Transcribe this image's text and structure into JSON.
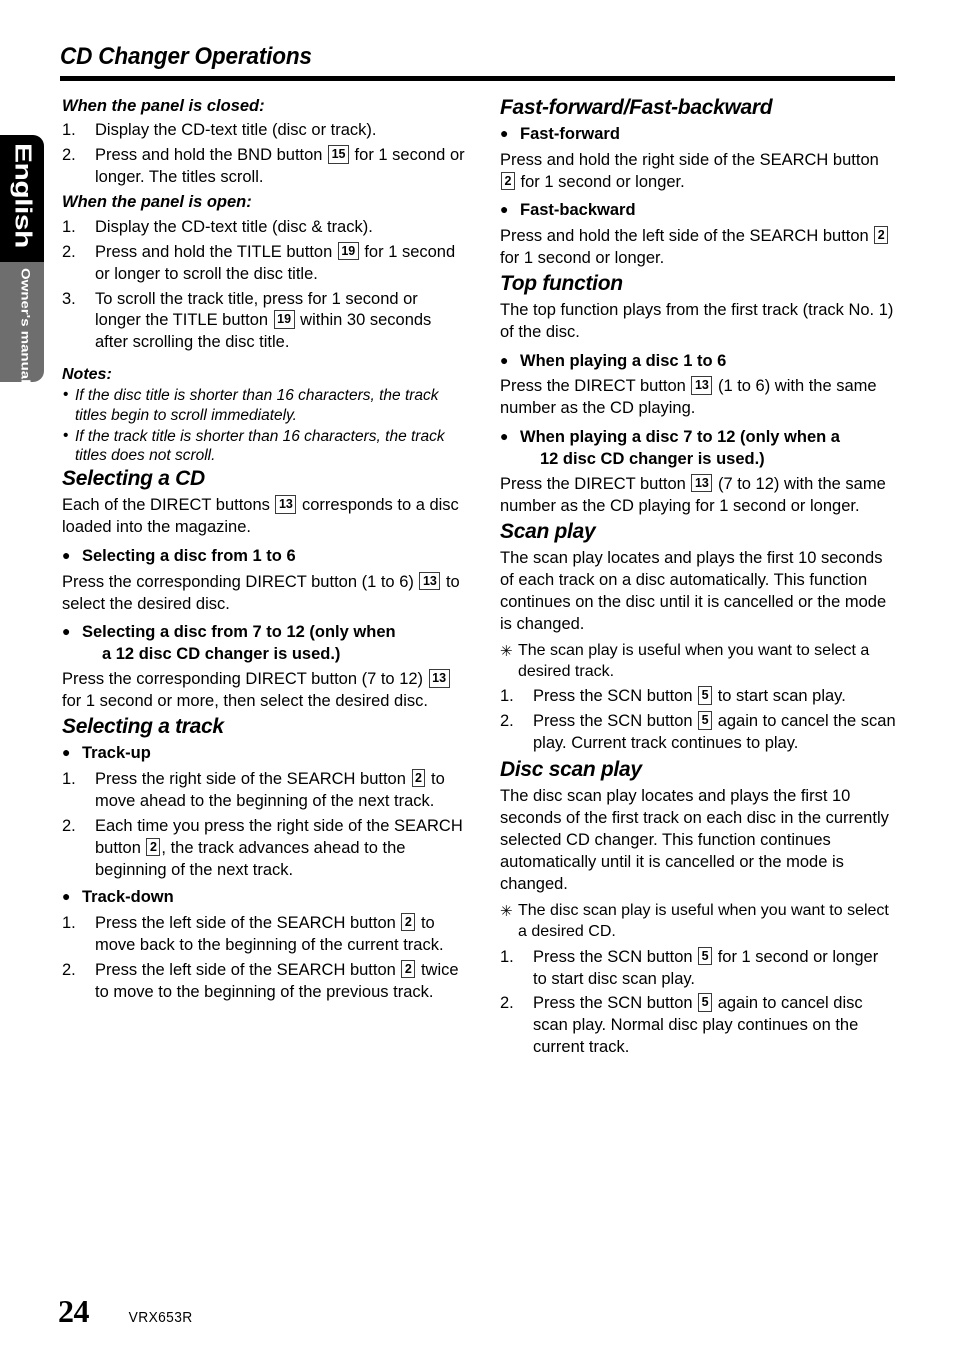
{
  "document": {
    "title": "CD Changer Operations",
    "language_tab": "English",
    "manual_tab": "Owner's manual",
    "page_number": "24",
    "model": "VRX653R"
  },
  "colors": {
    "tab_black": "#000000",
    "tab_gray": "#6e6e6e",
    "rule": "#000000",
    "text": "#000000"
  },
  "left_column": {
    "panel_closed": {
      "heading": "When the panel is closed:",
      "items": [
        {
          "num": "1.",
          "pre": "Display the CD-text title (disc or track).",
          "key": "",
          "post": ""
        },
        {
          "num": "2.",
          "pre": "Press and hold the BND button ",
          "key": "15",
          "post": " for 1 second or longer. The titles scroll."
        }
      ]
    },
    "panel_open": {
      "heading": "When the panel is open:",
      "items": [
        {
          "num": "1.",
          "pre": "Display the CD-text title (disc & track).",
          "key": "",
          "post": ""
        },
        {
          "num": "2.",
          "pre": "Press and hold the TITLE button ",
          "key": "19",
          "post": " for 1 second or longer to scroll the disc title."
        },
        {
          "num": "3.",
          "pre": "To scroll the track title, press for 1 second or longer the TITLE button ",
          "key": "19",
          "post": " within 30 seconds after scrolling the disc title."
        }
      ]
    },
    "notes": {
      "title": "Notes:",
      "items": [
        "If the disc title is shorter than 16 characters, the track titles begin to scroll immediately.",
        "If the track title is shorter than 16 characters, the track titles does not scroll."
      ]
    },
    "selecting_cd": {
      "heading": "Selecting a CD",
      "intro_pre": "Each of the DIRECT buttons ",
      "intro_key": "13",
      "intro_post": " corresponds to a disc loaded into the magazine.",
      "bullet1": "Selecting a disc from 1 to 6",
      "bullet1_body_pre": "Press the corresponding DIRECT button (1 to 6) ",
      "bullet1_body_key": "13",
      "bullet1_body_post": " to select the desired disc.",
      "bullet2_line1": "Selecting a disc from 7 to 12 (only when",
      "bullet2_line2": "a 12 disc CD changer is used.)",
      "bullet2_body_pre": "Press the corresponding DIRECT button (7 to 12) ",
      "bullet2_body_key": "13",
      "bullet2_body_post": " for 1 second or more, then select the desired disc."
    },
    "selecting_track": {
      "heading": "Selecting a track",
      "track_up": "Track-up",
      "track_up_items": [
        {
          "num": "1.",
          "pre": "Press the right side of the SEARCH button ",
          "key": "2",
          "post": " to move ahead to the beginning of the next track."
        },
        {
          "num": "2.",
          "pre": "Each time you press the right side of the SEARCH button ",
          "key": "2",
          "post": ", the track advances ahead to the beginning of the next track."
        }
      ],
      "track_down": "Track-down",
      "track_down_items": [
        {
          "num": "1.",
          "pre": "Press the left side of the SEARCH button ",
          "key": "2",
          "post": " to move back to the beginning of the current track."
        },
        {
          "num": "2.",
          "pre": "Press the left side of the SEARCH button ",
          "key": "2",
          "post": " twice to move to the beginning of the previous track."
        }
      ]
    }
  },
  "right_column": {
    "fast_fwd_back": {
      "heading": "Fast-forward/Fast-backward",
      "bullet1": "Fast-forward",
      "bullet1_body_pre": "Press and hold the right side of the SEARCH button ",
      "bullet1_body_key": "2",
      "bullet1_body_post": " for 1 second or longer.",
      "bullet2": "Fast-backward",
      "bullet2_body_pre": "Press and hold the left side of the SEARCH button ",
      "bullet2_body_key": "2",
      "bullet2_body_post": " for 1 second or longer."
    },
    "top_function": {
      "heading": "Top function",
      "intro": "The top function plays from the first track (track No. 1) of the disc.",
      "bullet1": "When playing a disc 1 to 6",
      "bullet1_body_pre": "Press the DIRECT button ",
      "bullet1_body_key": "13",
      "bullet1_body_post": " (1 to 6) with the same number as the CD playing.",
      "bullet2_line1": "When playing a disc 7 to 12 (only when a",
      "bullet2_line2": "12 disc CD changer is used.)",
      "bullet2_body_pre": "Press the DIRECT button ",
      "bullet2_body_key": "13",
      "bullet2_body_post": " (7 to 12) with the same number as the CD playing for 1 second or longer."
    },
    "scan_play": {
      "heading": "Scan play",
      "intro": "The scan play locates and plays the first 10 seconds of each track on a disc automatically. This function continues on the disc until it is cancelled or the mode is changed.",
      "star_note": "The scan play is useful when you want to select a  desired track.",
      "items": [
        {
          "num": "1.",
          "pre": "Press the SCN button ",
          "key": "5",
          "post": " to start scan play."
        },
        {
          "num": "2.",
          "pre": "Press the SCN button ",
          "key": "5",
          "post": " again to cancel the scan play. Current track continues to play."
        }
      ]
    },
    "disc_scan_play": {
      "heading": "Disc scan play",
      "intro": "The disc scan play locates and plays the first 10 seconds of the first track on each disc in the currently selected CD changer. This function continues automatically until it is cancelled or the mode is changed.",
      "star_note": "The disc scan play is useful when you want to select a desired CD.",
      "items": [
        {
          "num": "1.",
          "pre": "Press the SCN button ",
          "key": "5",
          "post": " for 1 second or longer to start disc scan play."
        },
        {
          "num": "2.",
          "pre": "Press the SCN button ",
          "key": "5",
          "post": " again to cancel disc scan play. Normal disc play continues on the current track."
        }
      ]
    }
  }
}
